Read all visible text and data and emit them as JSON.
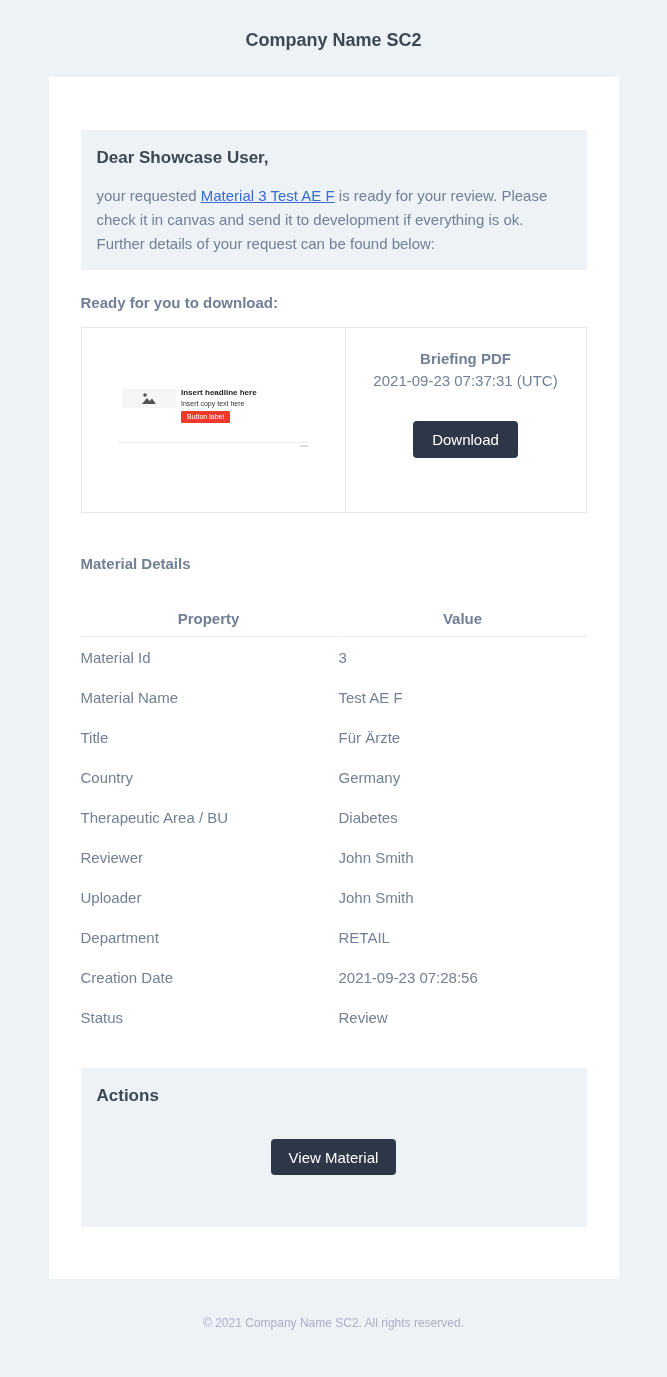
{
  "header": {
    "title": "Company Name SC2"
  },
  "greeting": {
    "title": "Dear Showcase User,",
    "text_before": "your requested",
    "link": "Material 3 Test AE F",
    "text_after": "is ready for your review. Please check it in canvas and send it to development if everything is ok. Further details of your request can be found below:"
  },
  "download": {
    "title": "Ready for you to download:",
    "preview": {
      "headline": "Insert headline here",
      "copy": "Insert copy text here",
      "button": "Button label"
    },
    "file_name": "Briefing PDF",
    "timestamp": "2021-09-23 07:37:31 (UTC)",
    "button": "Download"
  },
  "details": {
    "title": "Material Details",
    "columns": [
      "Property",
      "Value"
    ],
    "rows": [
      {
        "property": "Material Id",
        "value": "3"
      },
      {
        "property": "Material Name",
        "value": "Test AE F"
      },
      {
        "property": "Title",
        "value": "Für Ärzte"
      },
      {
        "property": "Country",
        "value": "Germany"
      },
      {
        "property": "Therapeutic Area / BU",
        "value": "Diabetes"
      },
      {
        "property": "Reviewer",
        "value": "John Smith"
      },
      {
        "property": "Uploader",
        "value": "John Smith"
      },
      {
        "property": "Department",
        "value": "RETAIL"
      },
      {
        "property": "Creation Date",
        "value": "2021-09-23 07:28:56"
      },
      {
        "property": "Status",
        "value": "Review"
      }
    ]
  },
  "actions": {
    "title": "Actions",
    "buttons": [
      "View Material"
    ]
  },
  "footer": {
    "text": "© 2021 Company Name SC2. All rights reserved."
  }
}
